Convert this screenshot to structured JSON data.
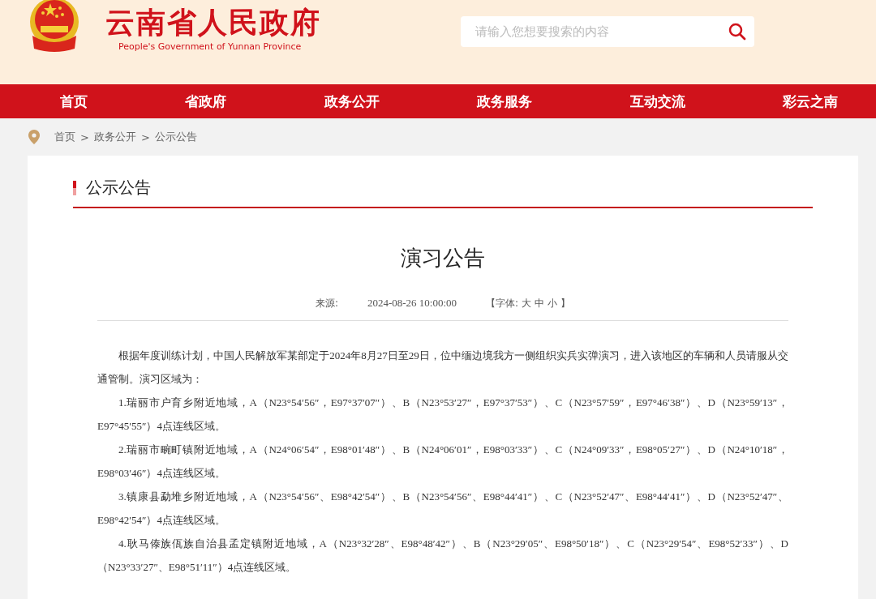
{
  "header": {
    "site_title": "云南省人民政府",
    "site_subtitle": "People's Government of Yunnan Province",
    "search": {
      "placeholder": "请输入您想要搜索的内容"
    }
  },
  "nav": [
    {
      "label": "首页",
      "selected": false
    },
    {
      "label": "省政府",
      "selected": false
    },
    {
      "label": "政务公开",
      "selected": false
    },
    {
      "label": "政务服务",
      "selected": false
    },
    {
      "label": "互动交流",
      "selected": false
    },
    {
      "label": "彩云之南",
      "selected": false
    }
  ],
  "breadcrumb": [
    "首页",
    "政务公开",
    "公示公告"
  ],
  "breadcrumb_separator": ">",
  "section_title": "公示公告",
  "article": {
    "title": "演习公告",
    "source_label": "来源:",
    "date": "2024-08-26 10:00:00",
    "font_size_label": "【字体:",
    "font_sizes": [
      "大",
      "中",
      "小"
    ],
    "font_size_end": "】",
    "paragraphs": [
      "根据年度训练计划，中国人民解放军某部定于2024年8月27日至29日，位中缅边境我方一侧组织实兵实弹演习，进入该地区的车辆和人员请服从交通管制。演习区域为：",
      "1.瑞丽市户育乡附近地域，A（N23°54′56″，E97°37′07″）、B（N23°53′27″，E97°37′53″）、C（N23°57′59″，E97°46′38″）、D（N23°59′13″，E97°45′55″）4点连线区域。",
      "2.瑞丽市畹町镇附近地域，A（N24°06′54″，E98°01′48″）、B（N24°06′01″，E98°03′33″）、C（N24°09′33″，E98°05′27″）、D（N24°10′18″，E98°03′46″）4点连线区域。",
      "3.镇康县勐堆乡附近地域，A（N23°54′56″、E98°42′54″）、B（N23°54′56″、E98°44′41″）、C（N23°52′47″、E98°44′41″）、D（N23°52′47″、E98°42′54″）4点连线区域。",
      "4.耿马傣族佤族自治县孟定镇附近地域，A（N23°32′28″、E98°48′42″）、B（N23°29′05″、E98°50′18″）、C（N23°29′54″、E98°52′33″）、D（N23°33′27″、E98°51′11″）4点连线区域。"
    ]
  }
}
